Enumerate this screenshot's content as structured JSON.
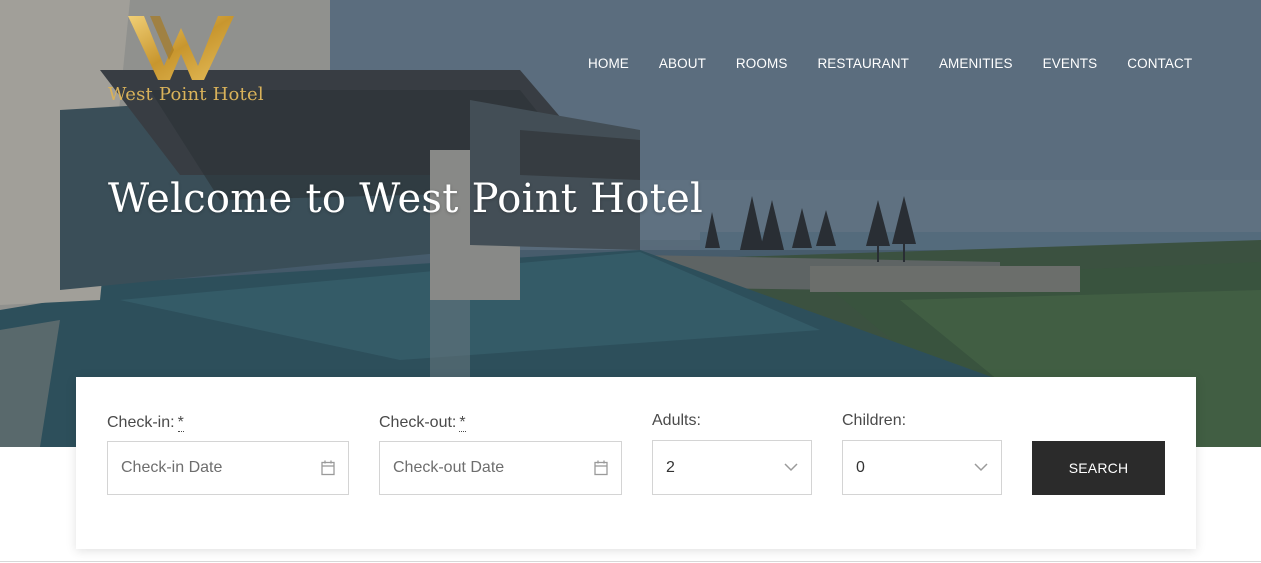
{
  "brand": {
    "name": "West Point Hotel",
    "accent_color": "#d9b25a",
    "logo_icon": "w-monogram-logo"
  },
  "nav": {
    "items": [
      "HOME",
      "ABOUT",
      "ROOMS",
      "RESTAURANT",
      "AMENITIES",
      "EVENTS",
      "CONTACT"
    ]
  },
  "hero": {
    "title": "Welcome to West Point Hotel"
  },
  "booking": {
    "checkin": {
      "label": "Check-in:",
      "required_mark": "*",
      "placeholder": "Check-in Date",
      "icon": "calendar-icon"
    },
    "checkout": {
      "label": "Check-out:",
      "required_mark": "*",
      "placeholder": "Check-out Date",
      "icon": "calendar-icon"
    },
    "adults": {
      "label": "Adults:",
      "value": "2",
      "icon": "chevron-down-icon"
    },
    "children": {
      "label": "Children:",
      "value": "0",
      "icon": "chevron-down-icon"
    },
    "search_label": "SEARCH",
    "search_button_color": "#2b2b2b"
  }
}
